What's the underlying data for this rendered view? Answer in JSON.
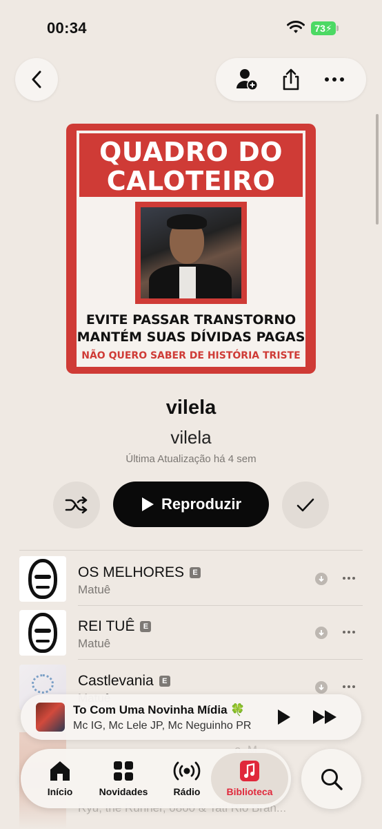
{
  "status_bar": {
    "time": "00:34",
    "battery": "73"
  },
  "nav": {
    "back_icon": "chevron-left-icon",
    "actions": [
      "add-person-icon",
      "share-icon",
      "more-icon"
    ]
  },
  "artwork": {
    "title": "QUADRO DO CALOTEIRO",
    "line1": "EVITE PASSAR TRANSTORNO",
    "line2": "MANTÉM SUAS DÍVIDAS PAGAS",
    "line3": "NÃO QUERO SABER DE HISTÓRIA TRISTE"
  },
  "playlist": {
    "title": "vilela",
    "owner": "vilela",
    "updated": "Última Atualização há 4 sem"
  },
  "controls": {
    "play_label": "Reproduzir"
  },
  "tracks": [
    {
      "title": "OS MELHORES",
      "explicit": "E",
      "artist": "Matuê"
    },
    {
      "title": "REI TUÊ",
      "explicit": "E",
      "artist": "Matuê"
    },
    {
      "title": "Castlevania",
      "explicit": "E",
      "artist": "Matuê"
    }
  ],
  "faded_rows": {
    "artist_partial": "Ryu, the Runner, 0800 & Tati Rio Bran...",
    "partial_right": "o, M..."
  },
  "mini_player": {
    "title": "To Com Uma Novinha Mídia 🍀",
    "artist": "Mc IG, Mc Lele JP, Mc Neguinho PR"
  },
  "tabs": [
    {
      "label": "Início",
      "icon": "home-icon"
    },
    {
      "label": "Novidades",
      "icon": "grid-icon"
    },
    {
      "label": "Rádio",
      "icon": "radio-icon"
    },
    {
      "label": "Biblioteca",
      "icon": "music-note-icon"
    }
  ],
  "colors": {
    "accent": "#e0283b",
    "background": "#efe9e3"
  }
}
